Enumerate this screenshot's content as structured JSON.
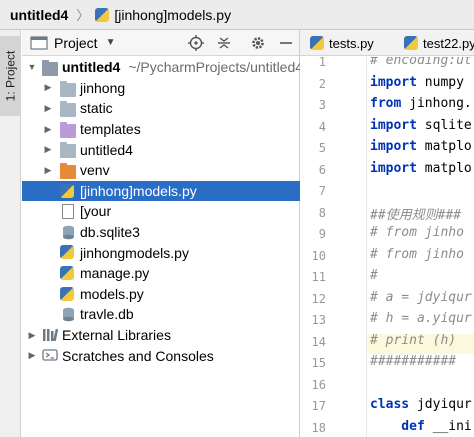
{
  "titlebar": {
    "project": "untitled4",
    "chevron": "〉",
    "file": "[jinhong]models.py"
  },
  "left_strip": {
    "tab_label": "1: Project"
  },
  "project_panel": {
    "header_label": "Project",
    "dropdown_glyph": "▼",
    "tree": [
      {
        "label": "untitled4",
        "sub": "~/PycharmProjects/untitled4",
        "icon": "folder-icon",
        "indent": 0,
        "expanded": true
      },
      {
        "label": "jinhong",
        "icon": "folder-icon",
        "indent": 1,
        "collapsed": true
      },
      {
        "label": "static",
        "icon": "folder-icon",
        "indent": 1,
        "collapsed": true
      },
      {
        "label": "templates",
        "icon": "folder-icon-purple",
        "indent": 1,
        "collapsed": true
      },
      {
        "label": "untitled4",
        "icon": "folder-icon",
        "indent": 1,
        "collapsed": true
      },
      {
        "label": "venv",
        "icon": "folder-icon-orange",
        "indent": 1,
        "collapsed": true
      },
      {
        "label": "[jinhong]models.py",
        "icon": "python-file-icon",
        "indent": 1,
        "selected": true
      },
      {
        "label": "[your",
        "icon": "text-file-icon",
        "indent": 1
      },
      {
        "label": "db.sqlite3",
        "icon": "database-file-icon",
        "indent": 1
      },
      {
        "label": "jinhongmodels.py",
        "icon": "python-file-icon",
        "indent": 1
      },
      {
        "label": "manage.py",
        "icon": "python-file-icon",
        "indent": 1
      },
      {
        "label": "models.py",
        "icon": "python-file-icon",
        "indent": 1
      },
      {
        "label": "travle.db",
        "icon": "database-file-icon",
        "indent": 1
      },
      {
        "label": "External Libraries",
        "icon": "library-icon",
        "indent": 0,
        "collapsed": true
      },
      {
        "label": "Scratches and Consoles",
        "icon": "scratches-icon",
        "indent": 0,
        "collapsed": true
      }
    ]
  },
  "editor": {
    "tabs": [
      {
        "label": "tests.py"
      },
      {
        "label": "test22.py"
      }
    ],
    "line_numbers": [
      "1",
      "2",
      "3",
      "4",
      "5",
      "6",
      "7",
      "8",
      "9",
      "10",
      "11",
      "12",
      "13",
      "14",
      "15",
      "16",
      "17",
      "18"
    ],
    "code_lines": [
      {
        "text": "# encoding:utf",
        "type": "comment"
      },
      {
        "kw": "import",
        "rest": " numpy",
        "type": "code"
      },
      {
        "kw": "from",
        "rest": " jinhong.",
        "type": "code"
      },
      {
        "kw": "import",
        "rest": " sqlite",
        "type": "code"
      },
      {
        "kw": "import",
        "rest": " matplo",
        "type": "code"
      },
      {
        "kw": "import",
        "rest": " matplo",
        "type": "code"
      },
      {
        "text": "",
        "type": "blank"
      },
      {
        "text": "##使用规则###",
        "type": "comment"
      },
      {
        "text": "# from jinho",
        "type": "comment"
      },
      {
        "text": "# from jinho",
        "type": "comment"
      },
      {
        "text": "#",
        "type": "comment"
      },
      {
        "text": "# a = jdyiqur",
        "type": "comment"
      },
      {
        "text": "# h = a.yiqur",
        "type": "comment"
      },
      {
        "text": "# print (h)",
        "type": "comment"
      },
      {
        "text": "###########",
        "type": "comment"
      },
      {
        "text": "",
        "type": "blank"
      },
      {
        "kw": "class",
        "rest": " jdyiqur",
        "type": "code"
      },
      {
        "kw": "    def",
        "rest": " __ini",
        "type": "code"
      }
    ],
    "highlighted_line": "13"
  },
  "colors": {
    "selection": "#2a6dc5",
    "folder": "#a9b7c4",
    "folder_purple": "#b99bdc",
    "folder_orange": "#e8893a",
    "keyword": "#0033b3",
    "comment": "#8c8c8c",
    "line_highlight": "#fbf8dc"
  }
}
